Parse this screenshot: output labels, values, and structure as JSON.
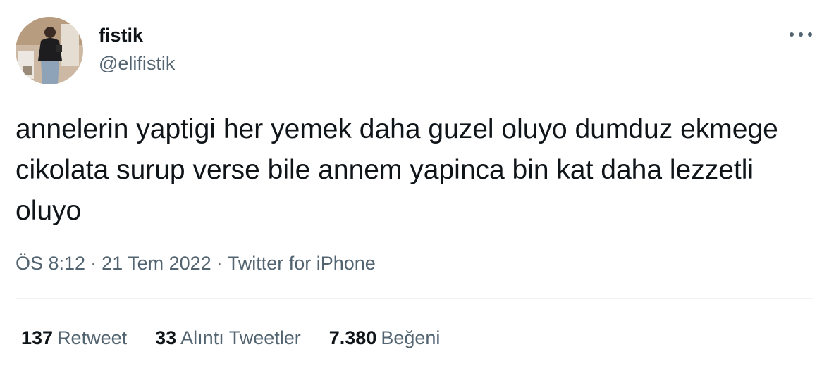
{
  "tweet": {
    "author": {
      "display_name": "fistik",
      "handle": "@elifistik",
      "avatar_icon": "profile-photo-icon"
    },
    "more_icon": "more-dots-icon",
    "text": "annelerin yaptigi her yemek daha guzel oluyo dumduz ekmege cikolata surup verse bile annem yapinca bin kat daha lezzetli oluyo",
    "time": "ÖS 8:12",
    "separator": "·",
    "date": "21 Tem 2022",
    "source": "Twitter for iPhone"
  },
  "stats": {
    "retweets": {
      "count": "137",
      "label": "Retweet"
    },
    "quotes": {
      "count": "33",
      "label": "Alıntı Tweetler"
    },
    "likes": {
      "count": "7.380",
      "label": "Beğeni"
    }
  },
  "colors": {
    "text_primary": "#0f1419",
    "text_secondary": "#536471",
    "divider": "#eff3f4"
  }
}
